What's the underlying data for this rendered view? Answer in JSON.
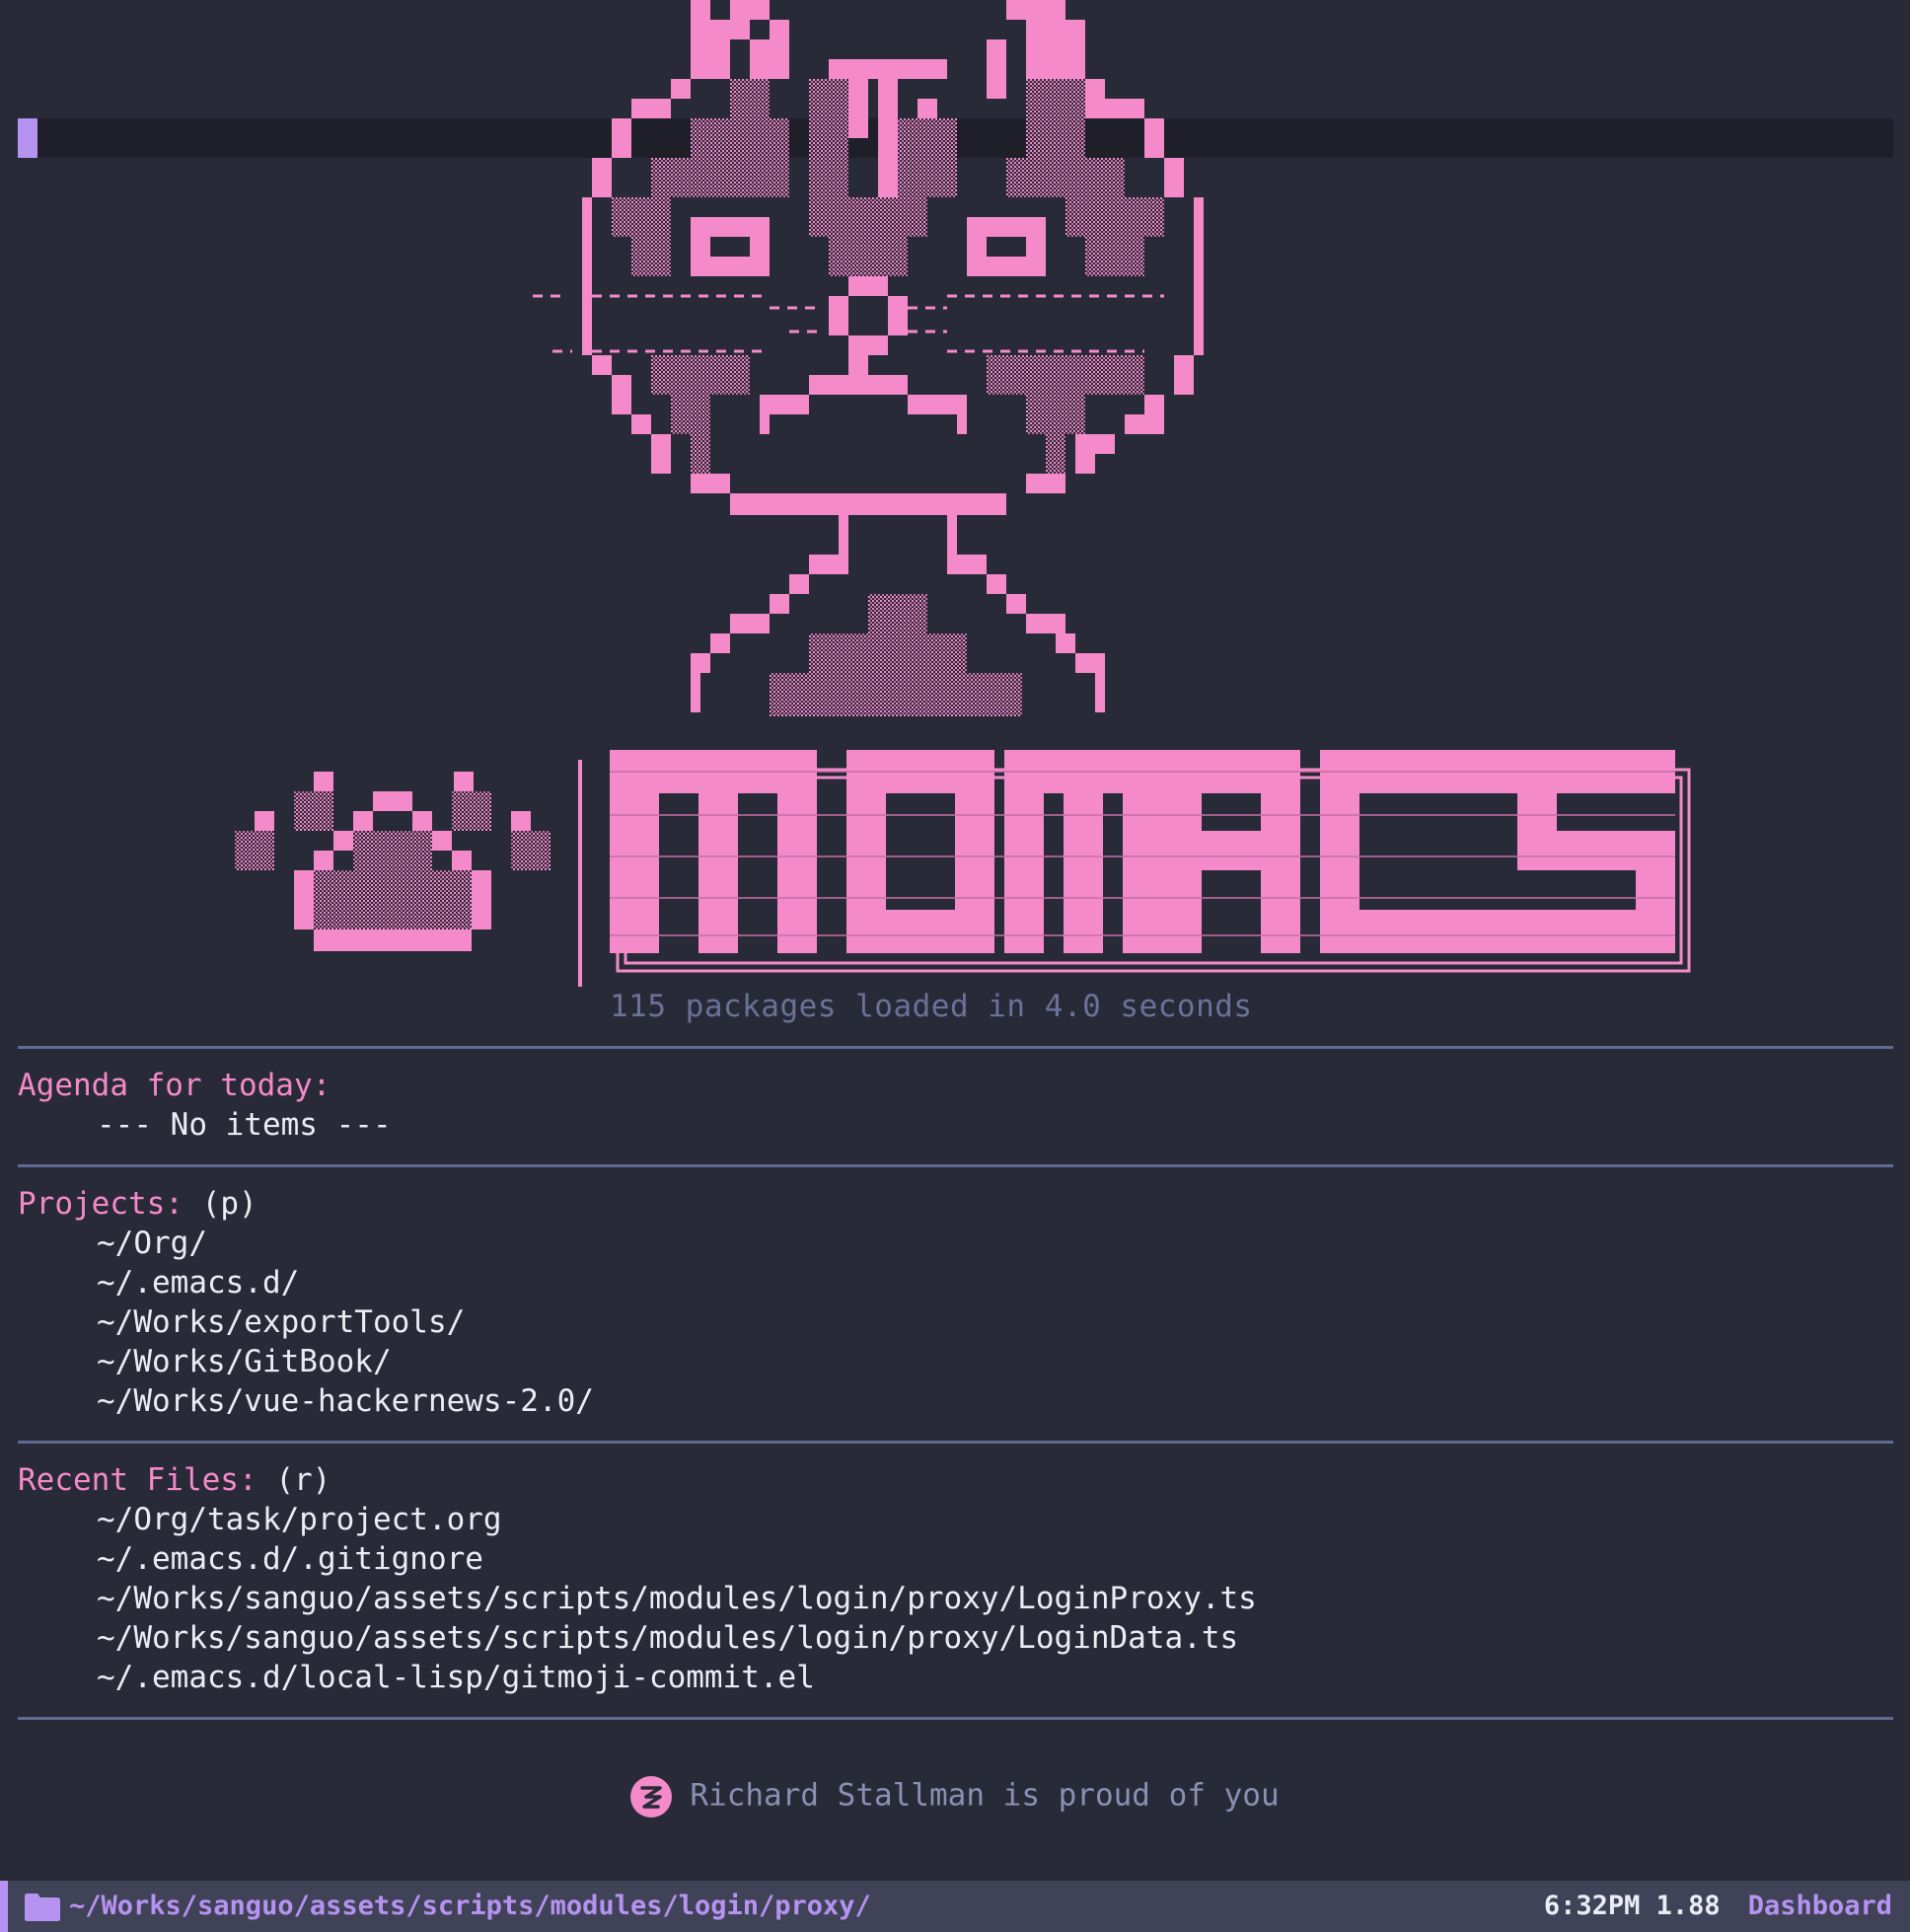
{
  "banner": {
    "subtitle": "115 packages loaded in 4.0 seconds",
    "logo_text": "MOMACS",
    "art_color": "#f48ac9",
    "logo_icon": "paw-print-icon",
    "mascot_icon": "pixel-cat-icon"
  },
  "agenda": {
    "title": "Agenda for today:",
    "empty": "--- No items ---"
  },
  "projects": {
    "title": "Projects:",
    "shortcut": "(p)",
    "items": [
      "~/Org/",
      "~/.emacs.d/",
      "~/Works/exportTools/",
      "~/Works/GitBook/",
      "~/Works/vue-hackernews-2.0/"
    ]
  },
  "recent": {
    "title": "Recent Files:",
    "shortcut": "(r)",
    "items": [
      "~/Org/task/project.org",
      "~/.emacs.d/.gitignore",
      "~/Works/sanguo/assets/scripts/modules/login/proxy/LoginProxy.ts",
      "~/Works/sanguo/assets/scripts/modules/login/proxy/LoginData.ts",
      "~/.emacs.d/local-lisp/gitmoji-commit.el"
    ]
  },
  "footer": {
    "message": "Richard Stallman is proud of you",
    "icon": "gnu-icon"
  },
  "modeline": {
    "path": "~/Works/sanguo/assets/scripts/modules/login/proxy/",
    "time": "6:32PM 1.88",
    "mode": "Dashboard",
    "folder_icon": "folder-icon"
  }
}
